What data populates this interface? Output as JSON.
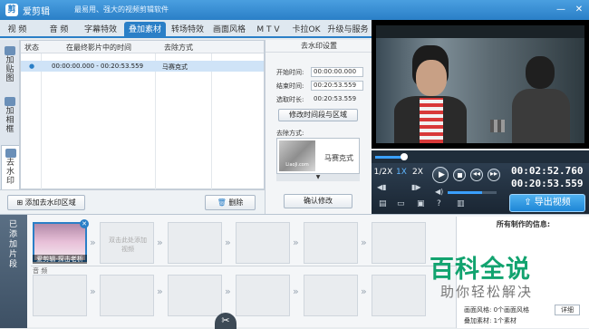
{
  "window": {
    "app_name": "爱剪辑",
    "slogan": "最易用、强大的视频剪辑软件",
    "logo_glyph": "剪",
    "minimize": "—",
    "close": "✕"
  },
  "tabs": [
    "视 频",
    "音 频",
    "字幕特效",
    "叠加素材",
    "转场特效",
    "画面风格",
    "M T V",
    "卡拉OK",
    "升级与服务"
  ],
  "active_tab": "叠加素材",
  "side_tabs": [
    "加贴图",
    "加相框",
    "去水印"
  ],
  "active_side_tab": "去水印",
  "table": {
    "headers": [
      "状态",
      "在最终影片中的时间",
      "去除方式"
    ],
    "rows": [
      {
        "status": "●",
        "time": "00:00:00.000 - 00:20:53.559",
        "method": "马赛克式"
      }
    ]
  },
  "left_buttons": {
    "add": "添加去水印区域",
    "delete": "删除"
  },
  "settings": {
    "title": "去水印设置",
    "start_label": "开始时间:",
    "start_value": "00:00:00.000",
    "end_label": "结束时间:",
    "end_value": "00:20:53.559",
    "duration_label": "选取时长:",
    "duration_value": "00:20:53.559",
    "modify_range": "修改时间段与区域",
    "method_label": "去除方式:",
    "method_value": "马赛克式",
    "thumb_caption": "LiaoJi.com",
    "confirm": "确认修改"
  },
  "player": {
    "speeds": [
      "1/2X",
      "1X",
      "2X"
    ],
    "current_time": "00:02:52.760",
    "total_time": "00:20:53.559",
    "export": "导出视频",
    "progress": 0.14,
    "volume": 0.7
  },
  "timeline": {
    "added_tab": "已添加片段",
    "clip_label": "爱剪辑-探击老析",
    "placeholder": "双击此处添加视频",
    "audio_label": "音 频",
    "cut_icon": "✂"
  },
  "info": {
    "title": "所有制作的信息:",
    "style_label": "画面风格:",
    "style_value": "0个画面风格",
    "overlay_label": "叠加素材:",
    "overlay_value": "1个素材",
    "detail": "详细"
  },
  "watermark": {
    "big": "百科全说",
    "small": "助你轻松解决"
  },
  "colors": {
    "accent": "#2a7fc7",
    "brand_green": "#12a36f"
  }
}
